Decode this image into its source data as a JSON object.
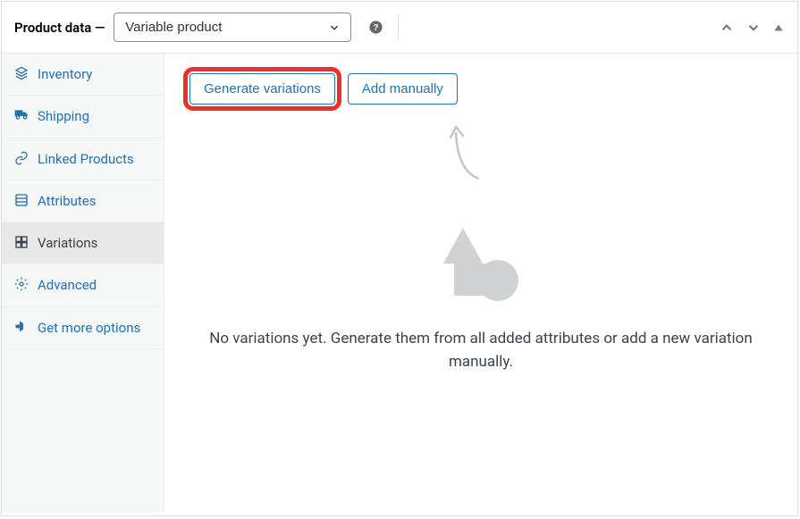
{
  "header": {
    "title": "Product data — ",
    "product_type": "Variable product"
  },
  "sidebar": {
    "items": [
      {
        "label": "Inventory"
      },
      {
        "label": "Shipping"
      },
      {
        "label": "Linked Products"
      },
      {
        "label": "Attributes"
      },
      {
        "label": "Variations"
      },
      {
        "label": "Advanced"
      },
      {
        "label": "Get more options"
      }
    ]
  },
  "main": {
    "generate_label": "Generate variations",
    "add_manually_label": "Add manually",
    "empty_text": "No variations yet. Generate them from all added attributes or add a new variation manually."
  }
}
